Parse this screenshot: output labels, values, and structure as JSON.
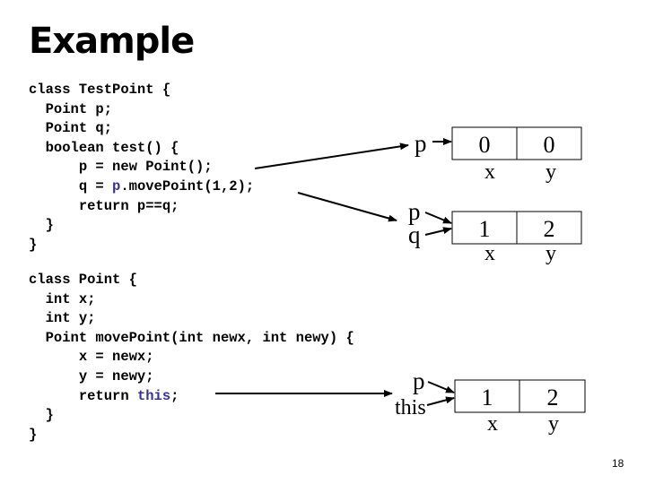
{
  "slide": {
    "title": "Example",
    "page_number": "18"
  },
  "code_block_1": {
    "lines": [
      {
        "indent": 0,
        "parts": [
          {
            "text": "class TestPoint {"
          }
        ]
      },
      {
        "indent": 1,
        "parts": [
          {
            "text": "Point p;"
          }
        ]
      },
      {
        "indent": 1,
        "parts": [
          {
            "text": "Point q;"
          }
        ]
      },
      {
        "indent": 1,
        "parts": [
          {
            "text": "boolean test() {"
          }
        ]
      },
      {
        "indent": 2,
        "parts": [
          {
            "text": "p = new Point();"
          }
        ]
      },
      {
        "indent": 2,
        "parts": [
          {
            "text": "q = "
          },
          {
            "text": "p",
            "highlight": true
          },
          {
            "text": ".movePoint(1,2);"
          }
        ]
      },
      {
        "indent": 2,
        "parts": [
          {
            "text": "return p==q;"
          }
        ]
      },
      {
        "indent": 1,
        "parts": [
          {
            "text": "}"
          }
        ]
      },
      {
        "indent": 0,
        "parts": [
          {
            "text": "}"
          }
        ]
      }
    ]
  },
  "code_block_2": {
    "lines": [
      {
        "indent": 0,
        "parts": [
          {
            "text": "class Point {"
          }
        ]
      },
      {
        "indent": 1,
        "parts": [
          {
            "text": "int x;"
          }
        ]
      },
      {
        "indent": 1,
        "parts": [
          {
            "text": "int y;"
          }
        ]
      },
      {
        "indent": 1,
        "parts": [
          {
            "text": "Point movePoint(int newx, int newy) {"
          }
        ]
      },
      {
        "indent": 2,
        "parts": [
          {
            "text": "x = newx;"
          }
        ]
      },
      {
        "indent": 2,
        "parts": [
          {
            "text": "y = newy;"
          }
        ]
      },
      {
        "indent": 2,
        "parts": [
          {
            "text": "return "
          },
          {
            "text": "this",
            "highlight": true
          },
          {
            "text": ";"
          }
        ]
      },
      {
        "indent": 1,
        "parts": [
          {
            "text": "}"
          }
        ]
      },
      {
        "indent": 0,
        "parts": [
          {
            "text": "}"
          }
        ]
      }
    ]
  },
  "diagrams": [
    {
      "refs": [
        "p"
      ],
      "fields": [
        {
          "value": "0",
          "label": "x"
        },
        {
          "value": "0",
          "label": "y"
        }
      ]
    },
    {
      "refs": [
        "p",
        "q"
      ],
      "fields": [
        {
          "value": "1",
          "label": "x"
        },
        {
          "value": "2",
          "label": "y"
        }
      ]
    },
    {
      "refs": [
        "p",
        "this"
      ],
      "fields": [
        {
          "value": "1",
          "label": "x"
        },
        {
          "value": "2",
          "label": "y"
        }
      ]
    }
  ],
  "colors": {
    "highlight": "#333399",
    "text": "#000000"
  }
}
